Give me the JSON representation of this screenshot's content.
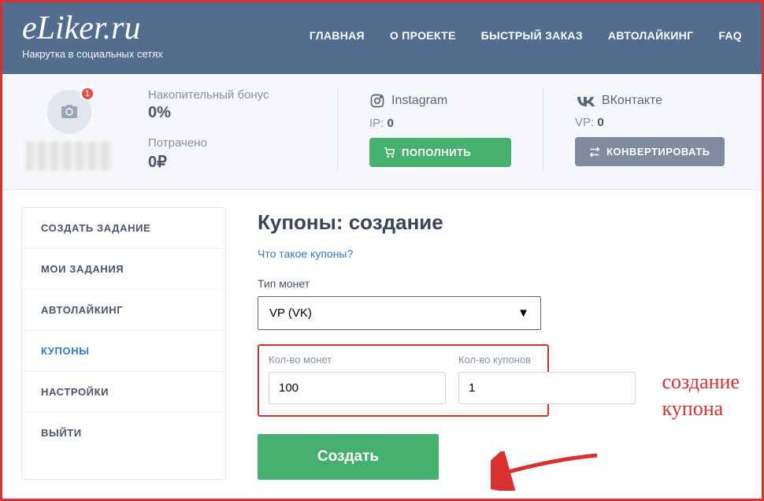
{
  "header": {
    "logo": "eLiker.ru",
    "tagline": "Накрутка в социальных сетях",
    "nav": [
      "ГЛАВНАЯ",
      "О ПРОЕКТЕ",
      "БЫСТРЫЙ ЗАКАЗ",
      "АВТОЛАЙКИНГ",
      "FAQ"
    ]
  },
  "stats": {
    "avatar_badge": "1",
    "bonus_label": "Накопительный бонус",
    "bonus_value": "0%",
    "spent_label": "Потрачено",
    "spent_value": "0₽",
    "instagram_label": "Instagram",
    "ip_label": "IP:",
    "ip_value": "0",
    "vk_label": "ВКонтакте",
    "vp_label": "VP:",
    "vp_value": "0",
    "topup_btn": "ПОПОЛНИТЬ",
    "convert_btn": "КОНВЕРТИРОВАТЬ"
  },
  "sidebar": {
    "items": [
      "СОЗДАТЬ ЗАДАНИЕ",
      "МОИ ЗАДАНИЯ",
      "АВТОЛАЙКИНГ",
      "КУПОНЫ",
      "НАСТРОЙКИ",
      "ВЫЙТИ"
    ],
    "active_index": 3
  },
  "main": {
    "title": "Купоны: создание",
    "help_link": "Что такое купоны?",
    "coin_type_label": "Тип монет",
    "coin_type_value": "VP (VK)",
    "coins_label": "Кол-во монет",
    "coins_value": "100",
    "coupons_label": "Кол-во купонов",
    "coupons_value": "1",
    "create_btn": "Создать"
  },
  "annotation": {
    "line1": "создание",
    "line2": "купона"
  }
}
